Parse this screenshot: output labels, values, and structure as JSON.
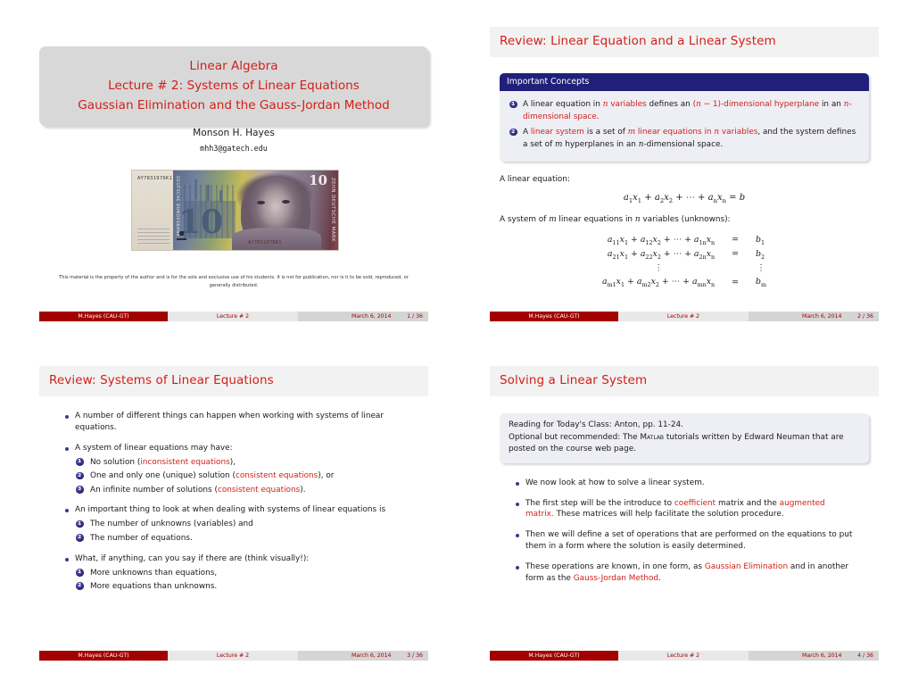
{
  "meta": {
    "doc_kind": "lecture-slide-handout",
    "colors": {
      "accent_red": "#d11f17",
      "footer_red": "#a30000",
      "block_navy": "#20207a",
      "title_gray": "#f2f2f2",
      "block_bg": "#eeeef5"
    }
  },
  "footer": {
    "author": "M.Hayes  (CAU-GT)",
    "title": "Lecture # 2",
    "date": "March 6, 2014",
    "pages": [
      "1 / 36",
      "2 / 36",
      "3 / 36",
      "4 / 36"
    ]
  },
  "slide1": {
    "title_lines": [
      "Linear Algebra",
      "Lecture # 2: Systems of Linear Equations",
      "Gaussian Elimination and the Gauss-Jordan Method"
    ],
    "author": "Monson H. Hayes",
    "email": "mhh3@gatech.edu",
    "image": {
      "name": "ten-deutsche-mark-gauss-banknote",
      "serial_left": "AY7831976K1",
      "serial_bottom": "AY7831976K1",
      "denomination": "10",
      "vertical_text_right": "ZEHN DEUTSCHE MARK",
      "vertical_text_left": "DEUTSCHE BUNDESBANK"
    },
    "disclaimer": "This material is the property of the author and is for the sole and exclusive use of his students. It is not for publication, nor is it to be sold, reproduced, or generally distributed."
  },
  "slide2": {
    "title": "Review: Linear Equation and a Linear System",
    "block_title": "Important Concepts",
    "concepts": [
      {
        "parts": [
          {
            "t": "A linear equation in ",
            "s": "n"
          },
          {
            "t": "n",
            "s": "mathred"
          },
          {
            "t": " variables",
            "s": "red"
          },
          {
            "t": " defines an ",
            "s": "n"
          },
          {
            "t": "(n − 1)-dimensional hyperplane",
            "s": "red"
          },
          {
            "t": " in an ",
            "s": "n"
          },
          {
            "t": "n-dimensional space",
            "s": "red"
          },
          {
            "t": ".",
            "s": "n"
          }
        ],
        "text": "A linear equation in n variables defines an (n − 1)-dimensional hyperplane in an n-dimensional space."
      },
      {
        "text": "A linear system is a set of m linear equations in n variables, and the system defines a set of m hyperplanes in an n-dimensional space."
      }
    ],
    "lead1": "A linear equation:",
    "equation1": "a₁x₁ + a₂x₂ + ⋯ + aₙxₙ = b",
    "lead2": "A system of m linear equations in n variables (unknowns):",
    "system_rows": [
      {
        "lhs": "a11x1 + a12x2 + ⋯ + a1nxn",
        "eq": "=",
        "rhs": "b1"
      },
      {
        "lhs": "a21x1 + a22x2 + ⋯ + a2nxn",
        "eq": "=",
        "rhs": "b2"
      },
      {
        "lhs": "⋮",
        "eq": "",
        "rhs": "⋮"
      },
      {
        "lhs": "am1x1 + am2x2 + ⋯ + amnxn",
        "eq": "=",
        "rhs": "bm"
      }
    ]
  },
  "slide3": {
    "title": "Review: Systems of Linear Equations",
    "item1": "A number of different things can happen when working with systems of linear equations.",
    "item2": "A system of linear equations may have:",
    "sub2": [
      "No solution (inconsistent equations),",
      "One and only one (unique) solution (consistent equations), or",
      "An infinite number of solutions (consistent equations)."
    ],
    "item3": "An important thing to look at when dealing with systems of linear equations is",
    "sub3": [
      "The number of unknowns (variables) and",
      "The number of equations."
    ],
    "item4": "What, if anything, can you say if there are (think visually!):",
    "sub4": [
      "More unknowns than equations,",
      "More equations than unknowns."
    ]
  },
  "slide4": {
    "title": "Solving a Linear System",
    "reading_lines": [
      "Reading for Today's Class: Anton, pp. 11-24.",
      "Optional but recommended: The MATLAB tutorials written by Edward",
      "Neuman that are posted on the course web page."
    ],
    "reading_line1": "Reading for Today's Class: Anton, pp. 11-24.",
    "reading_line2_a": "Optional but recommended: The ",
    "reading_line2_sc": "Matlab",
    "reading_line2_b": " tutorials written by Edward Neuman that are posted on the course web page.",
    "item1": "We now look at how to solve a linear system.",
    "item2_a": "The first step will be the introduce to ",
    "item2_hl1": "coefficient",
    "item2_b": " matrix and the ",
    "item2_hl2": "augmented matrix.",
    "item2_c": " These matrices will help facilitate the solution procedure.",
    "item3": "Then we will define a set of operations that are performed on the equations to put them in a form where the solution is easily determined.",
    "item4_a": "These operations are known, in one form, as ",
    "item4_hl1": "Gaussian Elimination",
    "item4_b": " and in another form as the ",
    "item4_hl2": "Gauss-Jordan Method",
    "item4_c": "."
  }
}
